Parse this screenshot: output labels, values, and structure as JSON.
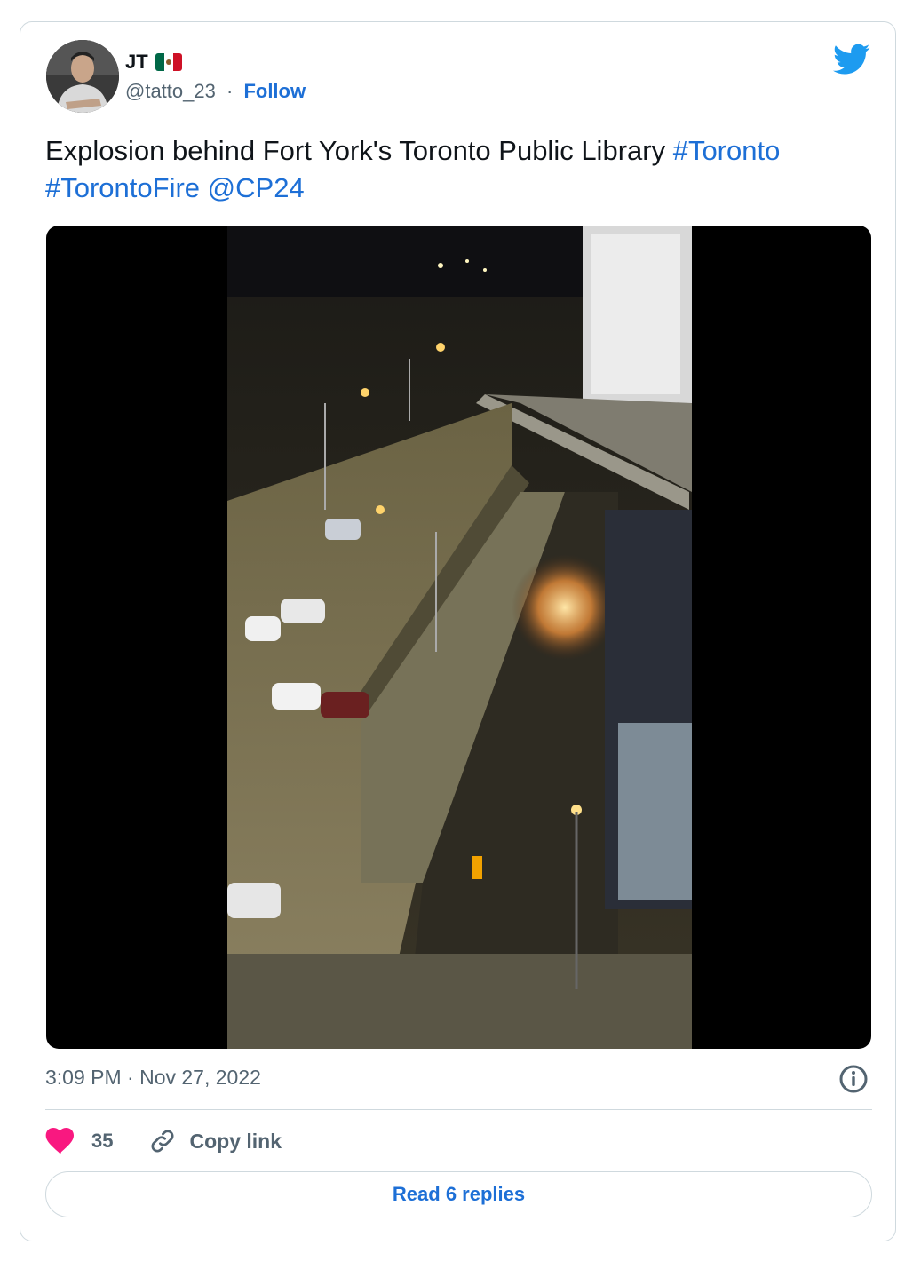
{
  "author": {
    "name": "JT",
    "flag_icon": "mexico-flag-icon",
    "handle": "@tatto_23",
    "separator": "·",
    "follow_label": "Follow"
  },
  "brand_icon": "twitter-bird-icon",
  "tweet": {
    "text_main": "Explosion behind Fort York's Toronto Public Library ",
    "hashtag1": "#Toronto",
    "hashtag2": "#TorontoFire",
    "mention": "@CP24"
  },
  "media": {
    "type": "video",
    "description_icon": "video-thumbnail"
  },
  "timestamp": "3:09 PM · Nov 27, 2022",
  "actions": {
    "likes_count": "35",
    "copy_link_label": "Copy link"
  },
  "replies_button": "Read 6 replies",
  "colors": {
    "link": "#1d6fd6",
    "heart": "#f91880",
    "bird": "#1d9bf0",
    "secondary_text": "#536471"
  }
}
